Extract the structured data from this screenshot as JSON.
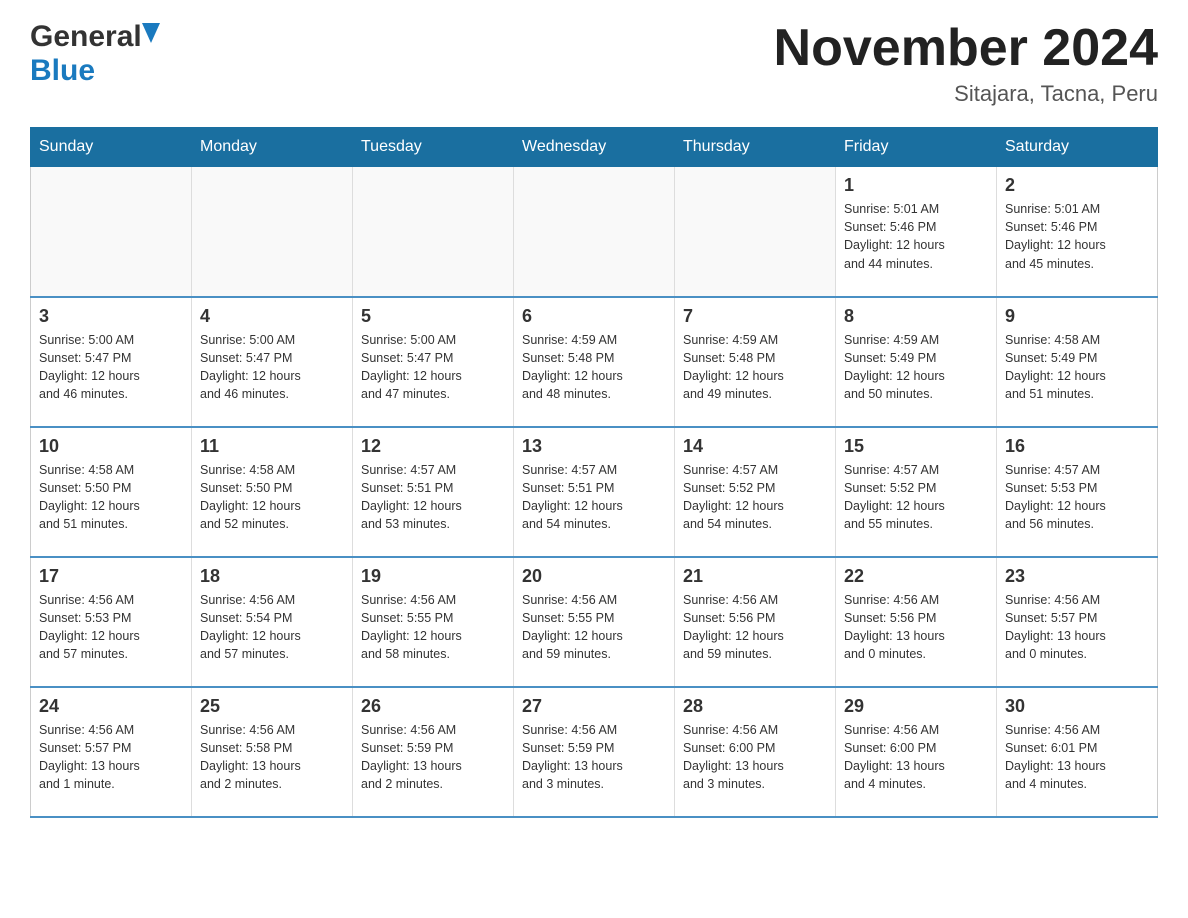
{
  "header": {
    "logo_general": "General",
    "logo_blue": "Blue",
    "title": "November 2024",
    "subtitle": "Sitajara, Tacna, Peru"
  },
  "calendar": {
    "weekdays": [
      "Sunday",
      "Monday",
      "Tuesday",
      "Wednesday",
      "Thursday",
      "Friday",
      "Saturday"
    ],
    "weeks": [
      [
        {
          "day": "",
          "info": ""
        },
        {
          "day": "",
          "info": ""
        },
        {
          "day": "",
          "info": ""
        },
        {
          "day": "",
          "info": ""
        },
        {
          "day": "",
          "info": ""
        },
        {
          "day": "1",
          "info": "Sunrise: 5:01 AM\nSunset: 5:46 PM\nDaylight: 12 hours\nand 44 minutes."
        },
        {
          "day": "2",
          "info": "Sunrise: 5:01 AM\nSunset: 5:46 PM\nDaylight: 12 hours\nand 45 minutes."
        }
      ],
      [
        {
          "day": "3",
          "info": "Sunrise: 5:00 AM\nSunset: 5:47 PM\nDaylight: 12 hours\nand 46 minutes."
        },
        {
          "day": "4",
          "info": "Sunrise: 5:00 AM\nSunset: 5:47 PM\nDaylight: 12 hours\nand 46 minutes."
        },
        {
          "day": "5",
          "info": "Sunrise: 5:00 AM\nSunset: 5:47 PM\nDaylight: 12 hours\nand 47 minutes."
        },
        {
          "day": "6",
          "info": "Sunrise: 4:59 AM\nSunset: 5:48 PM\nDaylight: 12 hours\nand 48 minutes."
        },
        {
          "day": "7",
          "info": "Sunrise: 4:59 AM\nSunset: 5:48 PM\nDaylight: 12 hours\nand 49 minutes."
        },
        {
          "day": "8",
          "info": "Sunrise: 4:59 AM\nSunset: 5:49 PM\nDaylight: 12 hours\nand 50 minutes."
        },
        {
          "day": "9",
          "info": "Sunrise: 4:58 AM\nSunset: 5:49 PM\nDaylight: 12 hours\nand 51 minutes."
        }
      ],
      [
        {
          "day": "10",
          "info": "Sunrise: 4:58 AM\nSunset: 5:50 PM\nDaylight: 12 hours\nand 51 minutes."
        },
        {
          "day": "11",
          "info": "Sunrise: 4:58 AM\nSunset: 5:50 PM\nDaylight: 12 hours\nand 52 minutes."
        },
        {
          "day": "12",
          "info": "Sunrise: 4:57 AM\nSunset: 5:51 PM\nDaylight: 12 hours\nand 53 minutes."
        },
        {
          "day": "13",
          "info": "Sunrise: 4:57 AM\nSunset: 5:51 PM\nDaylight: 12 hours\nand 54 minutes."
        },
        {
          "day": "14",
          "info": "Sunrise: 4:57 AM\nSunset: 5:52 PM\nDaylight: 12 hours\nand 54 minutes."
        },
        {
          "day": "15",
          "info": "Sunrise: 4:57 AM\nSunset: 5:52 PM\nDaylight: 12 hours\nand 55 minutes."
        },
        {
          "day": "16",
          "info": "Sunrise: 4:57 AM\nSunset: 5:53 PM\nDaylight: 12 hours\nand 56 minutes."
        }
      ],
      [
        {
          "day": "17",
          "info": "Sunrise: 4:56 AM\nSunset: 5:53 PM\nDaylight: 12 hours\nand 57 minutes."
        },
        {
          "day": "18",
          "info": "Sunrise: 4:56 AM\nSunset: 5:54 PM\nDaylight: 12 hours\nand 57 minutes."
        },
        {
          "day": "19",
          "info": "Sunrise: 4:56 AM\nSunset: 5:55 PM\nDaylight: 12 hours\nand 58 minutes."
        },
        {
          "day": "20",
          "info": "Sunrise: 4:56 AM\nSunset: 5:55 PM\nDaylight: 12 hours\nand 59 minutes."
        },
        {
          "day": "21",
          "info": "Sunrise: 4:56 AM\nSunset: 5:56 PM\nDaylight: 12 hours\nand 59 minutes."
        },
        {
          "day": "22",
          "info": "Sunrise: 4:56 AM\nSunset: 5:56 PM\nDaylight: 13 hours\nand 0 minutes."
        },
        {
          "day": "23",
          "info": "Sunrise: 4:56 AM\nSunset: 5:57 PM\nDaylight: 13 hours\nand 0 minutes."
        }
      ],
      [
        {
          "day": "24",
          "info": "Sunrise: 4:56 AM\nSunset: 5:57 PM\nDaylight: 13 hours\nand 1 minute."
        },
        {
          "day": "25",
          "info": "Sunrise: 4:56 AM\nSunset: 5:58 PM\nDaylight: 13 hours\nand 2 minutes."
        },
        {
          "day": "26",
          "info": "Sunrise: 4:56 AM\nSunset: 5:59 PM\nDaylight: 13 hours\nand 2 minutes."
        },
        {
          "day": "27",
          "info": "Sunrise: 4:56 AM\nSunset: 5:59 PM\nDaylight: 13 hours\nand 3 minutes."
        },
        {
          "day": "28",
          "info": "Sunrise: 4:56 AM\nSunset: 6:00 PM\nDaylight: 13 hours\nand 3 minutes."
        },
        {
          "day": "29",
          "info": "Sunrise: 4:56 AM\nSunset: 6:00 PM\nDaylight: 13 hours\nand 4 minutes."
        },
        {
          "day": "30",
          "info": "Sunrise: 4:56 AM\nSunset: 6:01 PM\nDaylight: 13 hours\nand 4 minutes."
        }
      ]
    ]
  }
}
